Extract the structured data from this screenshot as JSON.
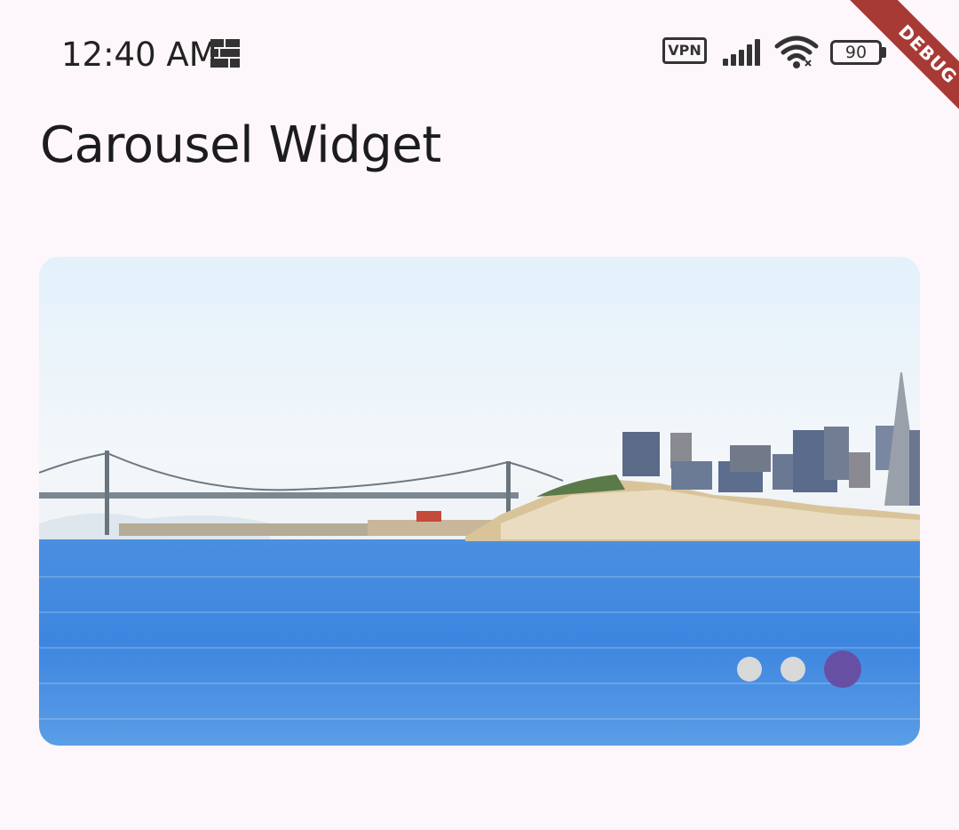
{
  "status_bar": {
    "time": "12:40 AM",
    "vpn_label": "VPN",
    "battery_level": "90",
    "icons": [
      "app-notification-icon",
      "vpn-icon",
      "cell-signal-icon",
      "wifi-icon",
      "battery-icon"
    ]
  },
  "debug_banner": {
    "label": "DEBUG",
    "color": "#a83a36"
  },
  "app_bar": {
    "title": "Carousel Widget"
  },
  "carousel": {
    "image_description_icon": "city-skyline-with-bridge-image",
    "page_count": 3,
    "active_page": 3,
    "indicator_active_color": "#6750a4",
    "indicator_inactive_color": "#d9d9d9"
  },
  "colors": {
    "background": "#fdf7fb",
    "text": "#1c1b1f"
  }
}
